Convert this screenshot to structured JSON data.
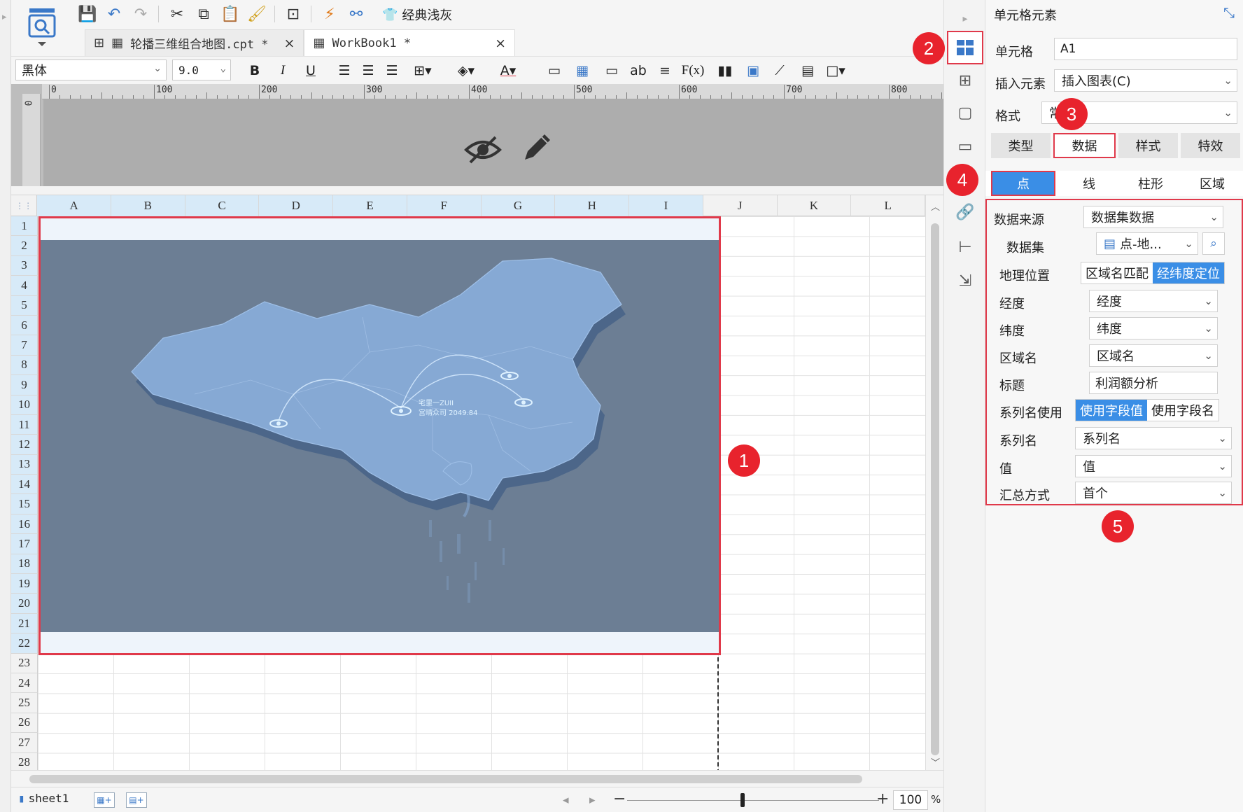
{
  "toolbar": {
    "theme_label": "经典浅灰"
  },
  "tabs": [
    {
      "label": "轮播三维组合地图.cpt *",
      "close": "×"
    },
    {
      "label": "WorkBook1 *",
      "close": "×"
    }
  ],
  "format": {
    "font_family": "黑体",
    "font_size": "9.0",
    "bold": "B",
    "italic": "I",
    "underline": "U",
    "text_ab": "ab",
    "formula": "F(x)"
  },
  "ruler": {
    "ticks": [
      "0",
      "100",
      "200",
      "300",
      "400",
      "500",
      "600",
      "700",
      "800"
    ],
    "left": "0"
  },
  "grid": {
    "columns": [
      "A",
      "B",
      "C",
      "D",
      "E",
      "F",
      "G",
      "H",
      "I",
      "J",
      "K",
      "L"
    ],
    "rows": [
      "1",
      "2",
      "3",
      "4",
      "5",
      "6",
      "7",
      "8",
      "9",
      "10",
      "11",
      "12",
      "13",
      "14",
      "15",
      "16",
      "17",
      "18",
      "19",
      "20",
      "21",
      "22",
      "23",
      "24",
      "25",
      "26",
      "27",
      "28"
    ]
  },
  "map": {
    "label_line1": "宅里一ZUII",
    "label_line2": "宫晴众司 2049.84"
  },
  "status": {
    "sheet": "sheet1",
    "zoom": "100",
    "zoom_unit": "%",
    "minus": "−",
    "plus": "+"
  },
  "panel": {
    "title": "单元格元素",
    "cell_label": "单元格",
    "cell_value": "A1",
    "insert_label": "插入元素",
    "insert_value": "插入图表(C)",
    "format_label": "格式",
    "format_value": "常",
    "tabs1": [
      "类型",
      "数据",
      "样式",
      "特效"
    ],
    "tabs2": [
      "点",
      "线",
      "柱形",
      "区域"
    ],
    "fields": {
      "source_label": "数据来源",
      "source_value": "数据集数据",
      "dataset_label": "数据集",
      "dataset_value": "点-地...",
      "geo_label": "地理位置",
      "geo_opt1": "区域名匹配",
      "geo_opt2": "经纬度定位",
      "lon_label": "经度",
      "lon_value": "经度",
      "lat_label": "纬度",
      "lat_value": "纬度",
      "area_label": "区域名",
      "area_value": "区域名",
      "title_label": "标题",
      "title_value": "利润额分析",
      "series_use_label": "系列名使用",
      "series_opt1": "使用字段值",
      "series_opt2": "使用字段名",
      "series_label": "系列名",
      "series_value": "系列名",
      "value_label": "值",
      "value_value": "值",
      "agg_label": "汇总方式",
      "agg_value": "首个"
    }
  },
  "badges": [
    "1",
    "2",
    "3",
    "4",
    "5"
  ],
  "colors": {
    "accent": "#3a8ee6",
    "highlight_red": "#e0394a",
    "badge_red": "#e8232d",
    "map_bg": "#6c7e94",
    "map_land": "#7fa0c8"
  }
}
